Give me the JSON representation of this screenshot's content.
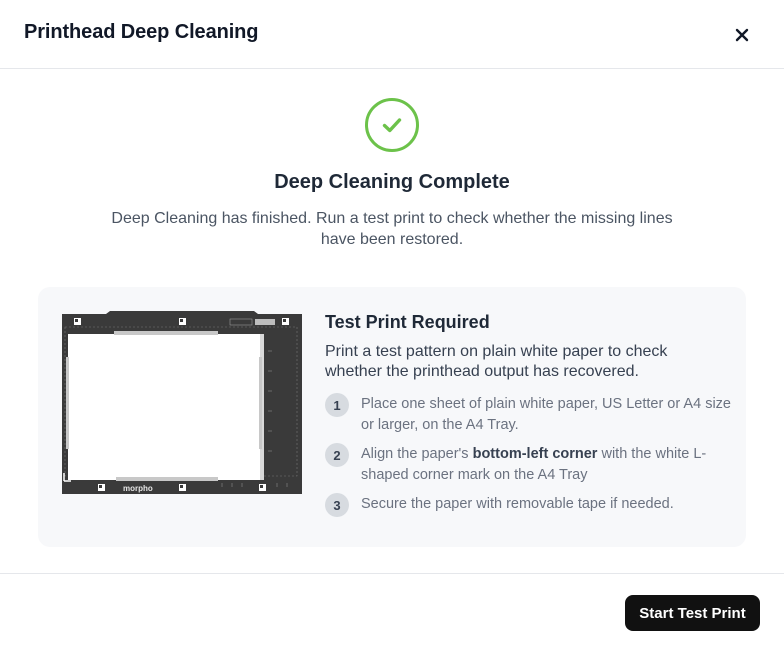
{
  "dialog": {
    "title": "Printhead Deep Cleaning",
    "close_icon": "close-icon"
  },
  "status": {
    "icon": "check-circle-icon",
    "accent_color": "#6cc24a",
    "heading": "Deep Cleaning Complete",
    "description": "Deep Cleaning has finished. Run a test print to check whether the missing lines have been restored."
  },
  "card": {
    "illustration": "print-tray-illustration",
    "tray_brand": "morpho",
    "title": "Test Print Required",
    "intro": "Print a test pattern on plain white paper to check whether the printhead output has recovered.",
    "steps": [
      {
        "number": "1",
        "text": "Place one sheet of plain white paper, US Letter or A4 size or larger, on the A4 Tray."
      },
      {
        "number": "2",
        "text_before": "Align the paper's ",
        "text_bold": "bottom-left corner",
        "text_after": " with the white L-shaped corner mark on the A4 Tray"
      },
      {
        "number": "3",
        "text": "Secure the paper with removable tape if needed."
      }
    ]
  },
  "footer": {
    "primary_button": "Start Test Print"
  }
}
